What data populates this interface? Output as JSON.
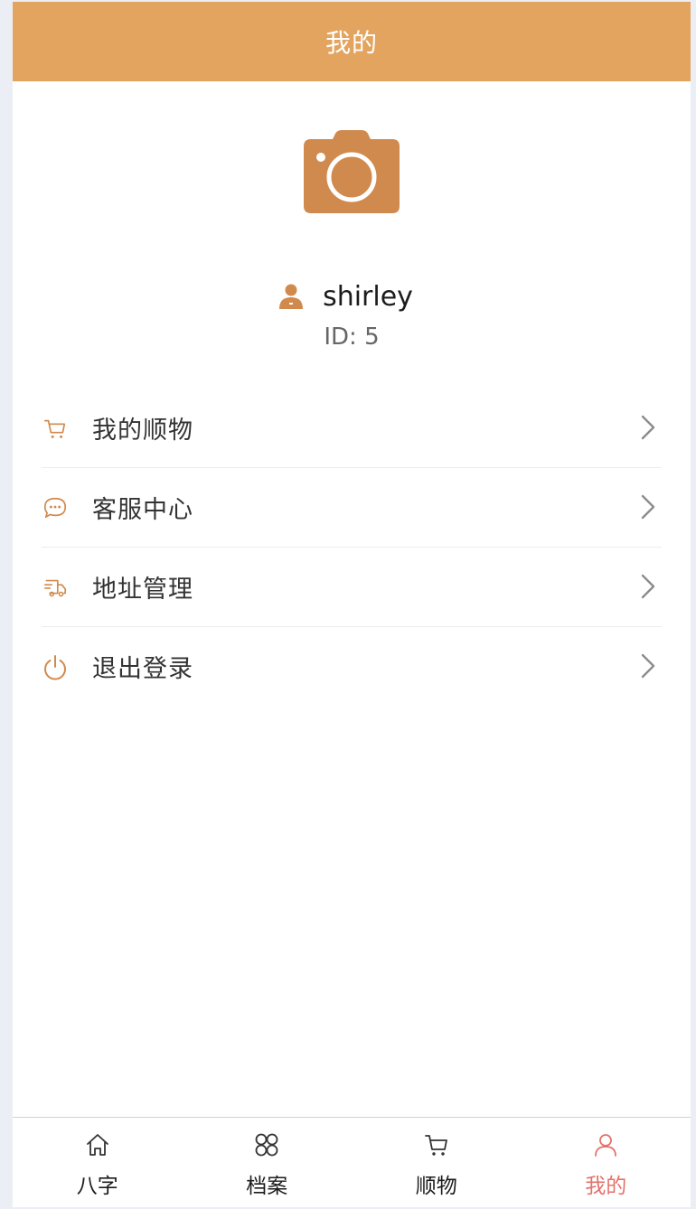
{
  "header": {
    "title": "我的"
  },
  "profile": {
    "username": "shirley",
    "id_text": "ID: 5"
  },
  "menu": {
    "items": [
      {
        "label": "我的顺物",
        "icon": "cart-icon"
      },
      {
        "label": "客服中心",
        "icon": "chat-bubble-icon"
      },
      {
        "label": "地址管理",
        "icon": "delivery-truck-icon"
      },
      {
        "label": "退出登录",
        "icon": "power-icon"
      }
    ]
  },
  "tabbar": {
    "tabs": [
      {
        "label": "八字",
        "icon": "home-icon",
        "active": false
      },
      {
        "label": "档案",
        "icon": "grid-clover-icon",
        "active": false
      },
      {
        "label": "顺物",
        "icon": "cart-icon",
        "active": false
      },
      {
        "label": "我的",
        "icon": "person-icon",
        "active": true
      }
    ]
  },
  "colors": {
    "accent": "#e3a45f",
    "icon": "#d18a4e",
    "active_tab": "#e5716a"
  }
}
